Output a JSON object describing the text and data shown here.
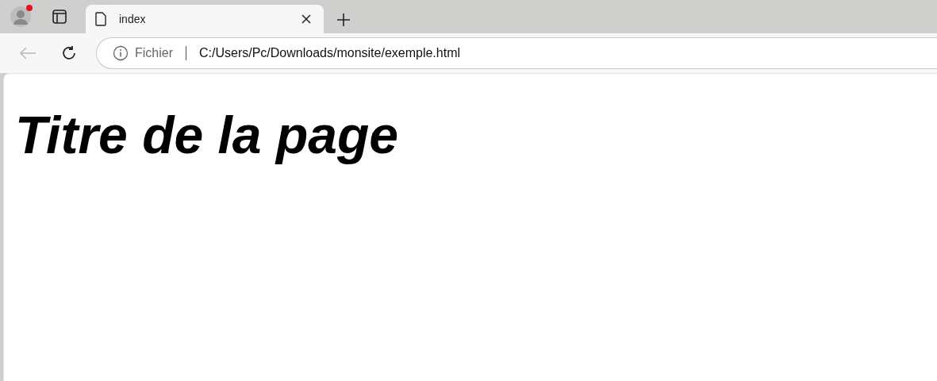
{
  "tabs": [
    {
      "title": "index",
      "selected": true
    }
  ],
  "toolbar": {
    "back_disabled": true
  },
  "address_bar": {
    "scheme": "Fichier",
    "url": "C:/Users/Pc/Downloads/monsite/exemple.html"
  },
  "page": {
    "heading": "Titre de la page"
  }
}
